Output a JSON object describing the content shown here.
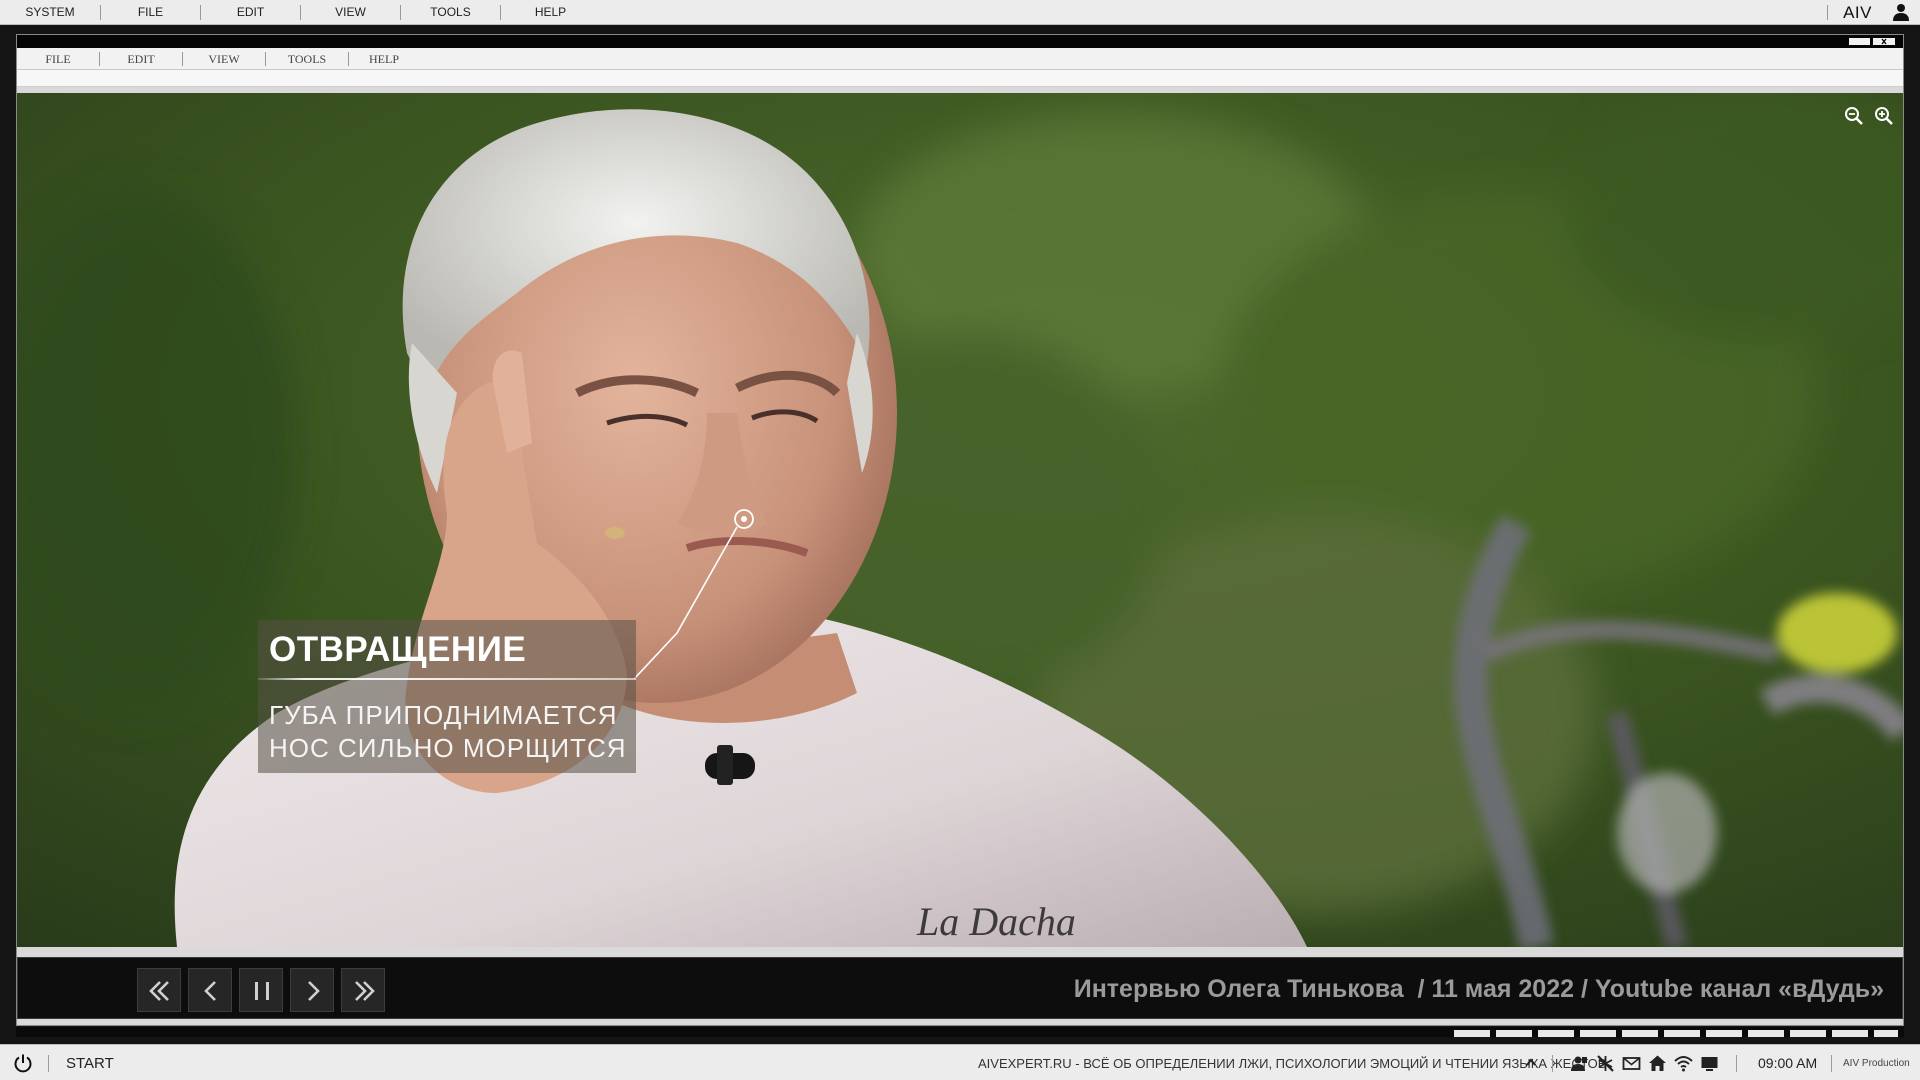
{
  "system_menu": {
    "items": [
      "SYSTEM",
      "FILE",
      "EDIT",
      "VIEW",
      "TOOLS",
      "HELP"
    ],
    "brand": "AIV"
  },
  "app_menu": {
    "items": [
      "FILE",
      "EDIT",
      "VIEW",
      "TOOLS",
      "HELP"
    ]
  },
  "caption": {
    "title": "ОТВРАЩЕНИЕ",
    "line1": "ГУБА ПРИПОДНИМАЕТСЯ",
    "line2": "НОС СИЛЬНО МОРЩИТСЯ"
  },
  "shirt_text": "La Dacha",
  "controls": {
    "buttons": [
      "rewind",
      "previous",
      "pause",
      "next",
      "fast-forward"
    ],
    "source_text": "Интервью Олега Тинькова  / 11 мая 2022 / Youtube канал «вДудь»"
  },
  "taskbar": {
    "start_label": "START",
    "ticker": "AIVEXPERT.RU - ВСЁ ОБ ОПРЕДЕЛЕНИИ ЛЖИ, ПСИХОЛОГИИ ЭМОЦИЙ И ЧТЕНИИ ЯЗЫКА ЖЕСТОВ",
    "tray_icons": [
      "chevron-up-icon",
      "user-icon",
      "network-off-icon",
      "mail-icon",
      "home-icon",
      "wifi-icon",
      "display-icon"
    ],
    "time": "09:00 AM",
    "credit": "AIV Production"
  },
  "colors": {
    "window_bg": "#d9d9d9",
    "menubar_bg": "#ececec",
    "control_bar_bg": "#0d0d0d",
    "source_text": "#9a9a9a",
    "caption_bg": "#565046"
  }
}
